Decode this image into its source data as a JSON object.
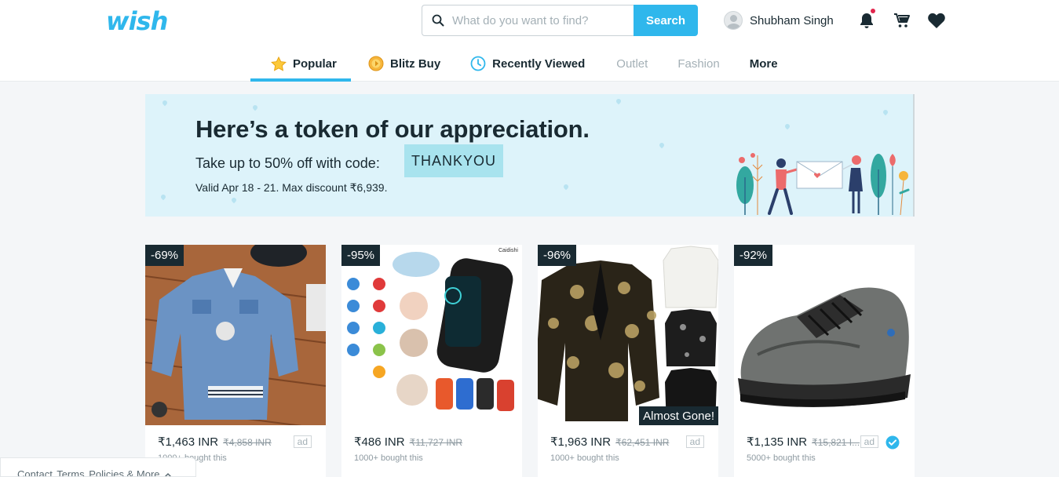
{
  "header": {
    "logo": "wish",
    "search_placeholder": "What do you want to find?",
    "search_button": "Search",
    "user_name": "Shubham Singh"
  },
  "tabs": [
    {
      "label": "Popular",
      "active": true,
      "icon": "star-icon"
    },
    {
      "label": "Blitz Buy",
      "icon": "blitz-buy-icon"
    },
    {
      "label": "Recently Viewed",
      "icon": "clock-icon"
    },
    {
      "label": "Outlet"
    },
    {
      "label": "Fashion"
    },
    {
      "label": "More"
    }
  ],
  "banner": {
    "title": "Here’s a token of our appreciation.",
    "subtitle": "Take up to 50% off with code:",
    "code": "THANKYOU",
    "valid": "Valid Apr 18 - 21. Max discount ₹6,939."
  },
  "products": [
    {
      "discount": "-69%",
      "price": "₹1,463 INR",
      "old_price": "₹4,858 INR",
      "ad": "ad",
      "bought": "1000+ bought this"
    },
    {
      "discount": "-95%",
      "price": "₹486 INR",
      "old_price": "₹11,727 INR",
      "bought": "1000+ bought this",
      "brand": "Caidishi"
    },
    {
      "discount": "-96%",
      "price": "₹1,963 INR",
      "old_price": "₹62,451 INR",
      "ad": "ad",
      "bought": "1000+ bought this",
      "flag": "Almost Gone!"
    },
    {
      "discount": "-92%",
      "price": "₹1,135 INR",
      "old_price": "₹15,821 I...",
      "ad": "ad",
      "bought": "5000+ bought this"
    }
  ],
  "footer": {
    "contact": "Contact",
    "terms": "Terms",
    "policies": "Policies & More"
  },
  "colors": {
    "brand": "#2fb7ec",
    "dark": "#192a32",
    "banner_bg": "#ddf3fa",
    "code_bg": "#a8e3ee",
    "notification": "#e2264d"
  }
}
